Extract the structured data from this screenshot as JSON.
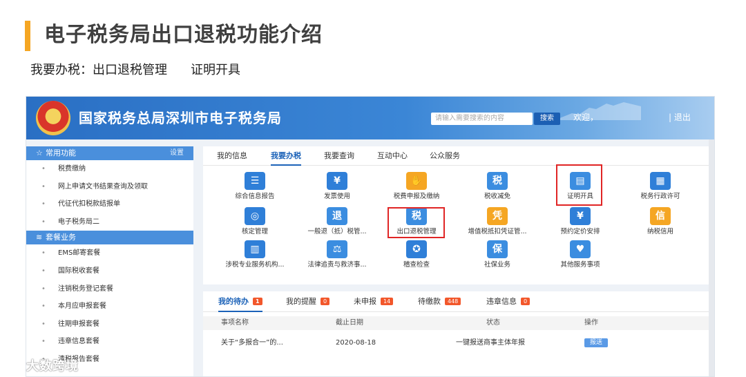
{
  "slide": {
    "title": "电子税务局出口退税功能介绍",
    "subtitle_prefix": "我要办税：出口退税管理",
    "subtitle_suffix": "证明开具",
    "accent_color": "#f5a623"
  },
  "header": {
    "site_name": "国家税务总局深圳市电子税务局",
    "search_placeholder": "请输入需要搜索的内容",
    "search_button": "搜索",
    "welcome": "欢迎，",
    "logout": "| 退出",
    "brand_color": "#2a6fc4"
  },
  "sidebar": {
    "common_header": "常用功能",
    "setting": "设置",
    "common_items": [
      "税费缴纳",
      "网上申请文书结果查询及领取",
      "代征代扣税款结报单",
      "电子税务局二"
    ],
    "package_header": "套餐业务",
    "package_items": [
      "EMS邮寄套餐",
      "国际税收套餐",
      "注销税务登记套餐",
      "本月应申报套餐",
      "往期申报套餐",
      "违章信息套餐",
      "清税报告套餐"
    ]
  },
  "tabs": [
    "我的信息",
    "我要办税",
    "我要查询",
    "互动中心",
    "公众服务"
  ],
  "functions": [
    {
      "label": "综合信息报告",
      "icon": "report-icon"
    },
    {
      "label": "发票使用",
      "icon": "invoice-icon"
    },
    {
      "label": "税费申报及缴纳",
      "icon": "declare-icon"
    },
    {
      "label": "税收减免",
      "icon": "tax-relief-icon"
    },
    {
      "label": "证明开具",
      "icon": "certificate-icon"
    },
    {
      "label": "税务行政许可",
      "icon": "license-icon"
    },
    {
      "label": "核定管理",
      "icon": "assessment-icon"
    },
    {
      "label": "一般退（抵）税管...",
      "icon": "refund-icon"
    },
    {
      "label": "出口退税管理",
      "icon": "export-refund-icon"
    },
    {
      "label": "增值税抵扣凭证管...",
      "icon": "voucher-icon"
    },
    {
      "label": "预约定价安排",
      "icon": "pricing-icon"
    },
    {
      "label": "纳税信用",
      "icon": "credit-icon"
    },
    {
      "label": "涉税专业服务机构...",
      "icon": "agency-icon"
    },
    {
      "label": "法律追责与救济事...",
      "icon": "legal-icon"
    },
    {
      "label": "稽查检查",
      "icon": "inspection-icon"
    },
    {
      "label": "社保业务",
      "icon": "social-security-icon"
    },
    {
      "label": "其他服务事项",
      "icon": "other-service-icon"
    }
  ],
  "todo": {
    "tabs": [
      {
        "label": "我的待办",
        "count": "1"
      },
      {
        "label": "我的提醒",
        "count": "0"
      },
      {
        "label": "未申报",
        "count": "14"
      },
      {
        "label": "待缴款",
        "count": "448"
      },
      {
        "label": "违章信息",
        "count": "0"
      }
    ],
    "columns": [
      "事项名称",
      "截止日期",
      "状态",
      "操作"
    ],
    "rows": [
      {
        "name": "关于“多报合一”的...",
        "deadline": "2020-08-18",
        "status": "一键报送商事主体年报",
        "action": "报送"
      }
    ]
  },
  "watermark": "大数跨境"
}
